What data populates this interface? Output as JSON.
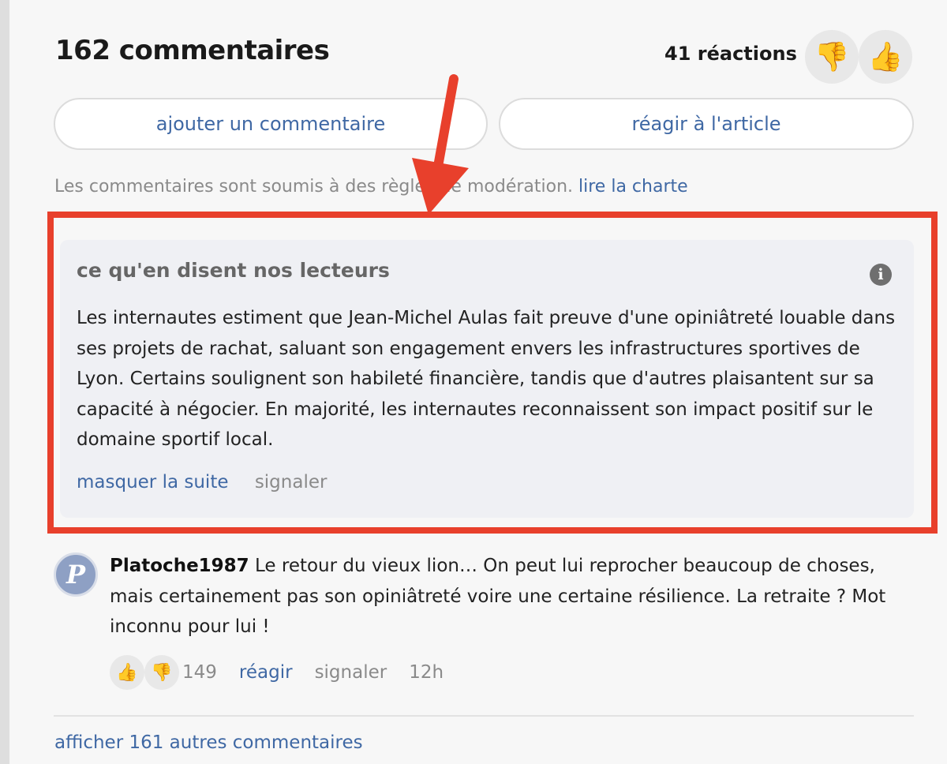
{
  "header": {
    "title": "162 commentaires",
    "reactions_label": "41 réactions",
    "thumbs_down_icon": "thumbs-down-emoji",
    "thumbs_up_icon": "thumbs-up-emoji"
  },
  "actions": {
    "add_comment": "ajouter un commentaire",
    "react_article": "réagir à l'article"
  },
  "moderation": {
    "text": "Les commentaires sont soumis à des règles de modération. ",
    "link": "lire la charte"
  },
  "summary": {
    "title": "ce qu'en disent nos lecteurs",
    "info_icon": "i",
    "body": "Les internautes estiment que Jean-Michel Aulas fait preuve d'une opiniâtreté louable dans ses projets de rachat, saluant son engagement envers les infrastructures sportives de Lyon. Certains soulignent son habileté financière, tandis que d'autres plaisantent sur sa capacité à négocier. En majorité, les internautes reconnaissent son impact positif sur le domaine sportif local.",
    "hide_label": "masquer la suite",
    "report_label": "signaler"
  },
  "comment": {
    "avatar_letter": "P",
    "author": "Platoche1987",
    "text": " Le retour du vieux lion… On peut lui reprocher beaucoup de choses, mais certainement pas son opiniâtreté voire une certaine résilience. La retraite ? Mot inconnu pour lui !",
    "reaction_count": "149",
    "reply_label": "réagir",
    "report_label": "signaler",
    "time": "12h"
  },
  "footer": {
    "more_comments": "afficher 161 autres commentaires"
  },
  "colors": {
    "accent_link": "#3f68a4",
    "highlight": "#e8402c",
    "card_bg": "#eff0f4"
  }
}
